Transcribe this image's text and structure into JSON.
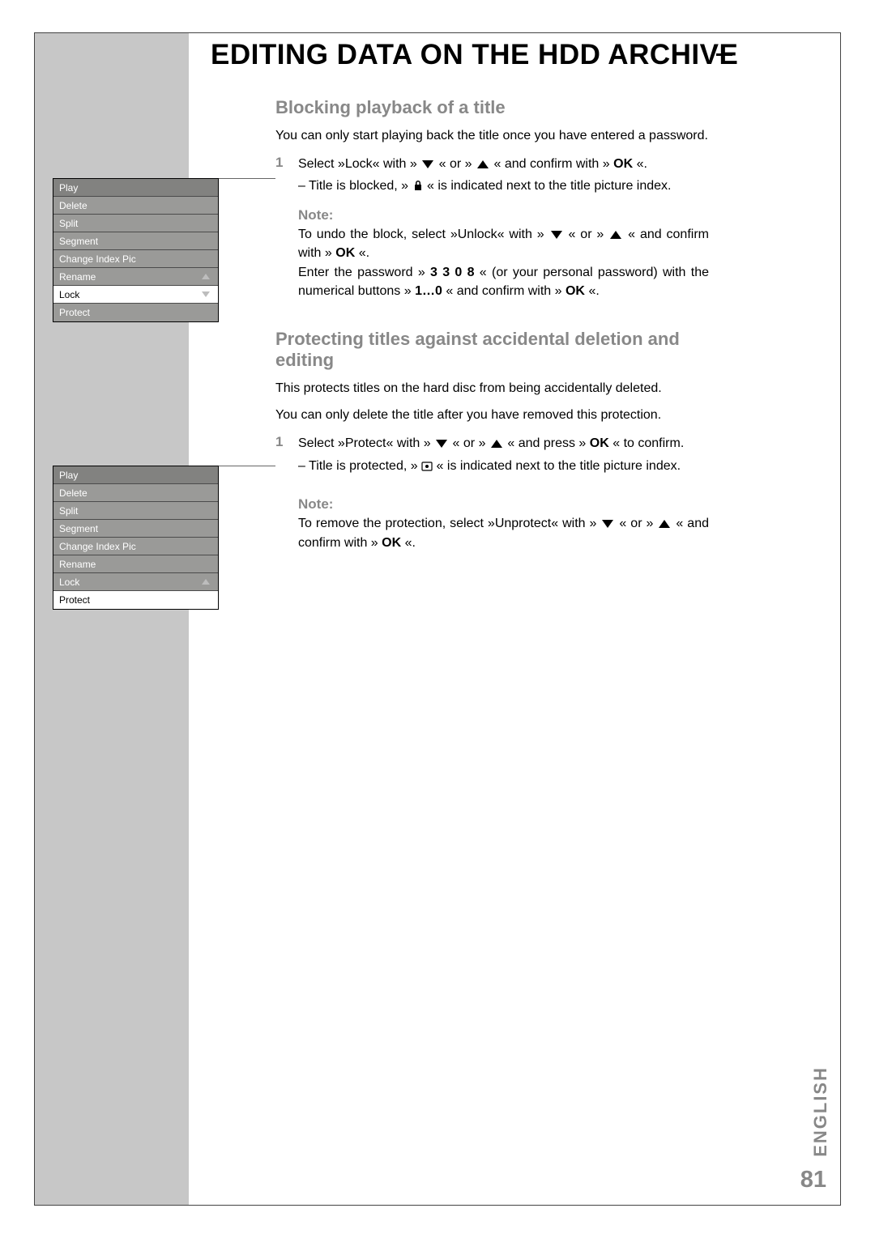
{
  "header": {
    "title": "EDITING DATA ON THE HDD ARCHIVE"
  },
  "section1": {
    "heading": "Blocking playback of a title",
    "intro": "You can only start playing back the title once you have entered a password.",
    "step_num": "1",
    "step_a": "Select  »Lock« with »",
    "step_b": "« or »",
    "step_c": "« and confirm with »",
    "step_ok": "OK",
    "step_d": "«.",
    "bullet_a": "– Title is blocked, »",
    "bullet_b": "« is indicated next to the title picture index.",
    "note_label": "Note:",
    "note1_a": "To undo the block, select »Unlock« with »",
    "note1_b": "« or »",
    "note1_c": "« and confirm with »",
    "note1_ok": "OK",
    "note1_d": "«.",
    "note2_a": "Enter the password »",
    "note2_pwd": "3 3 0 8",
    "note2_b": "« (or your personal password) with the numerical buttons »",
    "note2_btns": "1…0",
    "note2_c": "« and confirm with »",
    "note2_ok": "OK",
    "note2_d": "«."
  },
  "section2": {
    "heading": "Protecting titles against accidental deletion and editing",
    "p1": "This protects titles on the hard disc from being accidentally deleted.",
    "p2": "You can only delete the title after you have removed this protection.",
    "step_num": "1",
    "step_a": "Select »Protect« with »",
    "step_b": "« or »",
    "step_c": "« and press »",
    "step_ok": "OK",
    "step_d": "« to confirm.",
    "bullet_a": "– Title  is  protected,  »",
    "bullet_b": "«  is  indicated  next  to  the  title picture index.",
    "note_label": "Note:",
    "note_a": "To remove the protection, select »Unprotect« with »",
    "note_b": "« or »",
    "note_c": "« and confirm with »",
    "note_ok": "OK",
    "note_d": "«."
  },
  "menu1": {
    "items": [
      "Play",
      "Delete",
      "Split",
      "Segment",
      "Change Index Pic",
      "Rename",
      "Lock",
      "Protect"
    ],
    "selected": "Lock"
  },
  "menu2": {
    "items": [
      "Play",
      "Delete",
      "Split",
      "Segment",
      "Change Index Pic",
      "Rename",
      "Lock",
      "Protect"
    ],
    "selected": "Protect"
  },
  "footer": {
    "language": "ENGLISH",
    "page": "81"
  }
}
